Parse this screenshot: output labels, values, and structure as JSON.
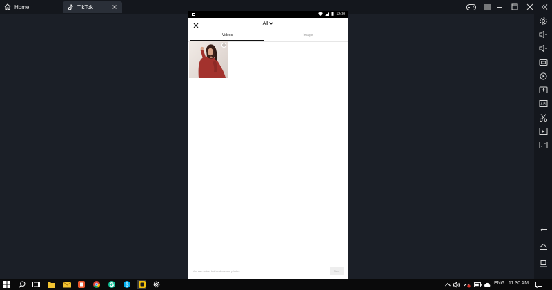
{
  "window": {
    "home_tab": "Home",
    "app_tab": "TikTok"
  },
  "device": {
    "status_time": "12:30"
  },
  "picker": {
    "album_label": "All",
    "tabs": [
      "Videos",
      "Image"
    ],
    "selected_tab": "Videos",
    "media_count": 1,
    "hint": "You can select both videos and photos",
    "next_label": "Next"
  },
  "taskbar": {
    "language": "ENG",
    "clock": "11:30 AM"
  },
  "colors": {
    "background": "#1b1f27",
    "chrome": "#14171d",
    "taskbar": "#0a0a0b",
    "phone_bg": "#ffffff"
  },
  "icons": {
    "sidebar": [
      "settings-icon",
      "volume-up-icon",
      "volume-down-icon",
      "screen-record-icon",
      "rotate-icon",
      "screenshot-icon",
      "apk-icon",
      "cut-icon",
      "media-icon",
      "sync-icon",
      "back-icon",
      "home-icon",
      "recents-icon"
    ]
  }
}
